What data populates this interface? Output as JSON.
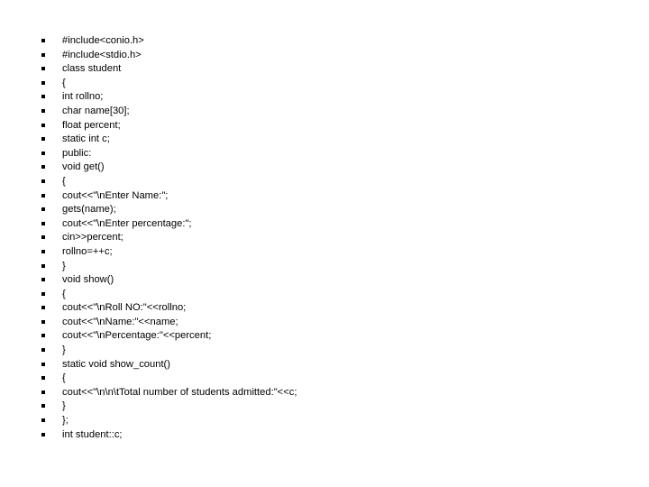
{
  "slide": {
    "background_color": "#ffffff",
    "text_color": "#000000",
    "bullet_glyph": "square-bullet",
    "bullet_color": "#000000"
  },
  "code_list": {
    "lines": [
      {
        "text": "#include<conio.h>"
      },
      {
        "text": "#include<stdio.h>"
      },
      {
        "text": "class student"
      },
      {
        "text": "{"
      },
      {
        "text": "int rollno;"
      },
      {
        "text": "char name[30];"
      },
      {
        "text": "float percent;"
      },
      {
        "text": "static int c;"
      },
      {
        "text": "public:"
      },
      {
        "text": "void get()"
      },
      {
        "text": "{"
      },
      {
        "text": "cout<<\"\\nEnter Name:\";"
      },
      {
        "text": "gets(name);"
      },
      {
        "text": "cout<<\"\\nEnter percentage:\";"
      },
      {
        "text": "cin>>percent;"
      },
      {
        "text": "rollno=++c;"
      },
      {
        "text": "}"
      },
      {
        "text": "void show()"
      },
      {
        "text": "{"
      },
      {
        "text": "cout<<\"\\nRoll NO:\"<<rollno;"
      },
      {
        "text": "cout<<\"\\nName:\"<<name;"
      },
      {
        "text": "cout<<\"\\nPercentage:\"<<percent;"
      },
      {
        "text": "}"
      },
      {
        "text": "static void show_count()"
      },
      {
        "text": "{"
      },
      {
        "text": "cout<<\"\\n\\n\\tTotal number of students admitted:\"<<c;"
      },
      {
        "text": "}"
      },
      {
        "text": "};"
      },
      {
        "text": "int student::c;"
      }
    ]
  }
}
